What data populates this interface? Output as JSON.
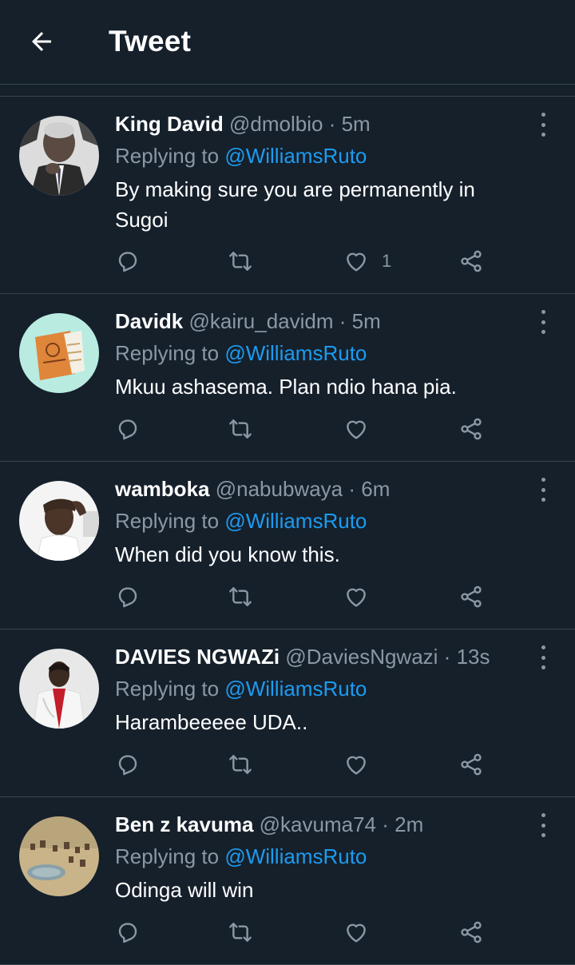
{
  "header": {
    "title": "Tweet"
  },
  "tweets": [
    {
      "name": "King David",
      "handle": "@dmolbio",
      "sep": " · ",
      "time": "5m",
      "reply_prefix": "Replying to ",
      "reply_to": "@WilliamsRuto",
      "text": "By making sure you are permanently in Sugoi",
      "like_count": "1"
    },
    {
      "name": "Davidk",
      "handle": "@kairu_davidm",
      "sep": " · ",
      "time": "5m",
      "reply_prefix": "Replying to ",
      "reply_to": "@WilliamsRuto",
      "text": "Mkuu ashasema. Plan ndio hana pia.",
      "like_count": ""
    },
    {
      "name": "wamboka",
      "handle": "@nabubwaya",
      "sep": " · ",
      "time": "6m",
      "reply_prefix": "Replying to ",
      "reply_to": "@WilliamsRuto",
      "text": "When did you know this.",
      "like_count": ""
    },
    {
      "name": "DAVIES NGWAZi",
      "handle": "@DaviesNgwazi",
      "sep": " · ",
      "time": "13s",
      "reply_prefix": "Replying to ",
      "reply_to": "@WilliamsRuto",
      "text": "Harambeeeee UDA..",
      "like_count": ""
    },
    {
      "name": "Ben z kavuma",
      "handle": "@kavuma74",
      "sep": " · ",
      "time": "2m",
      "reply_prefix": "Replying to ",
      "reply_to": "@WilliamsRuto",
      "text": "Odinga will win",
      "like_count": ""
    }
  ],
  "colors": {
    "background": "#15202b",
    "divider": "#38444d",
    "secondary_text": "#8b98a5",
    "link": "#1d9bf0"
  },
  "icons": {
    "back": "arrow-left-icon",
    "more": "more-vertical-icon",
    "reply": "reply-icon",
    "retweet": "retweet-icon",
    "like": "heart-icon",
    "share": "share-icon"
  }
}
